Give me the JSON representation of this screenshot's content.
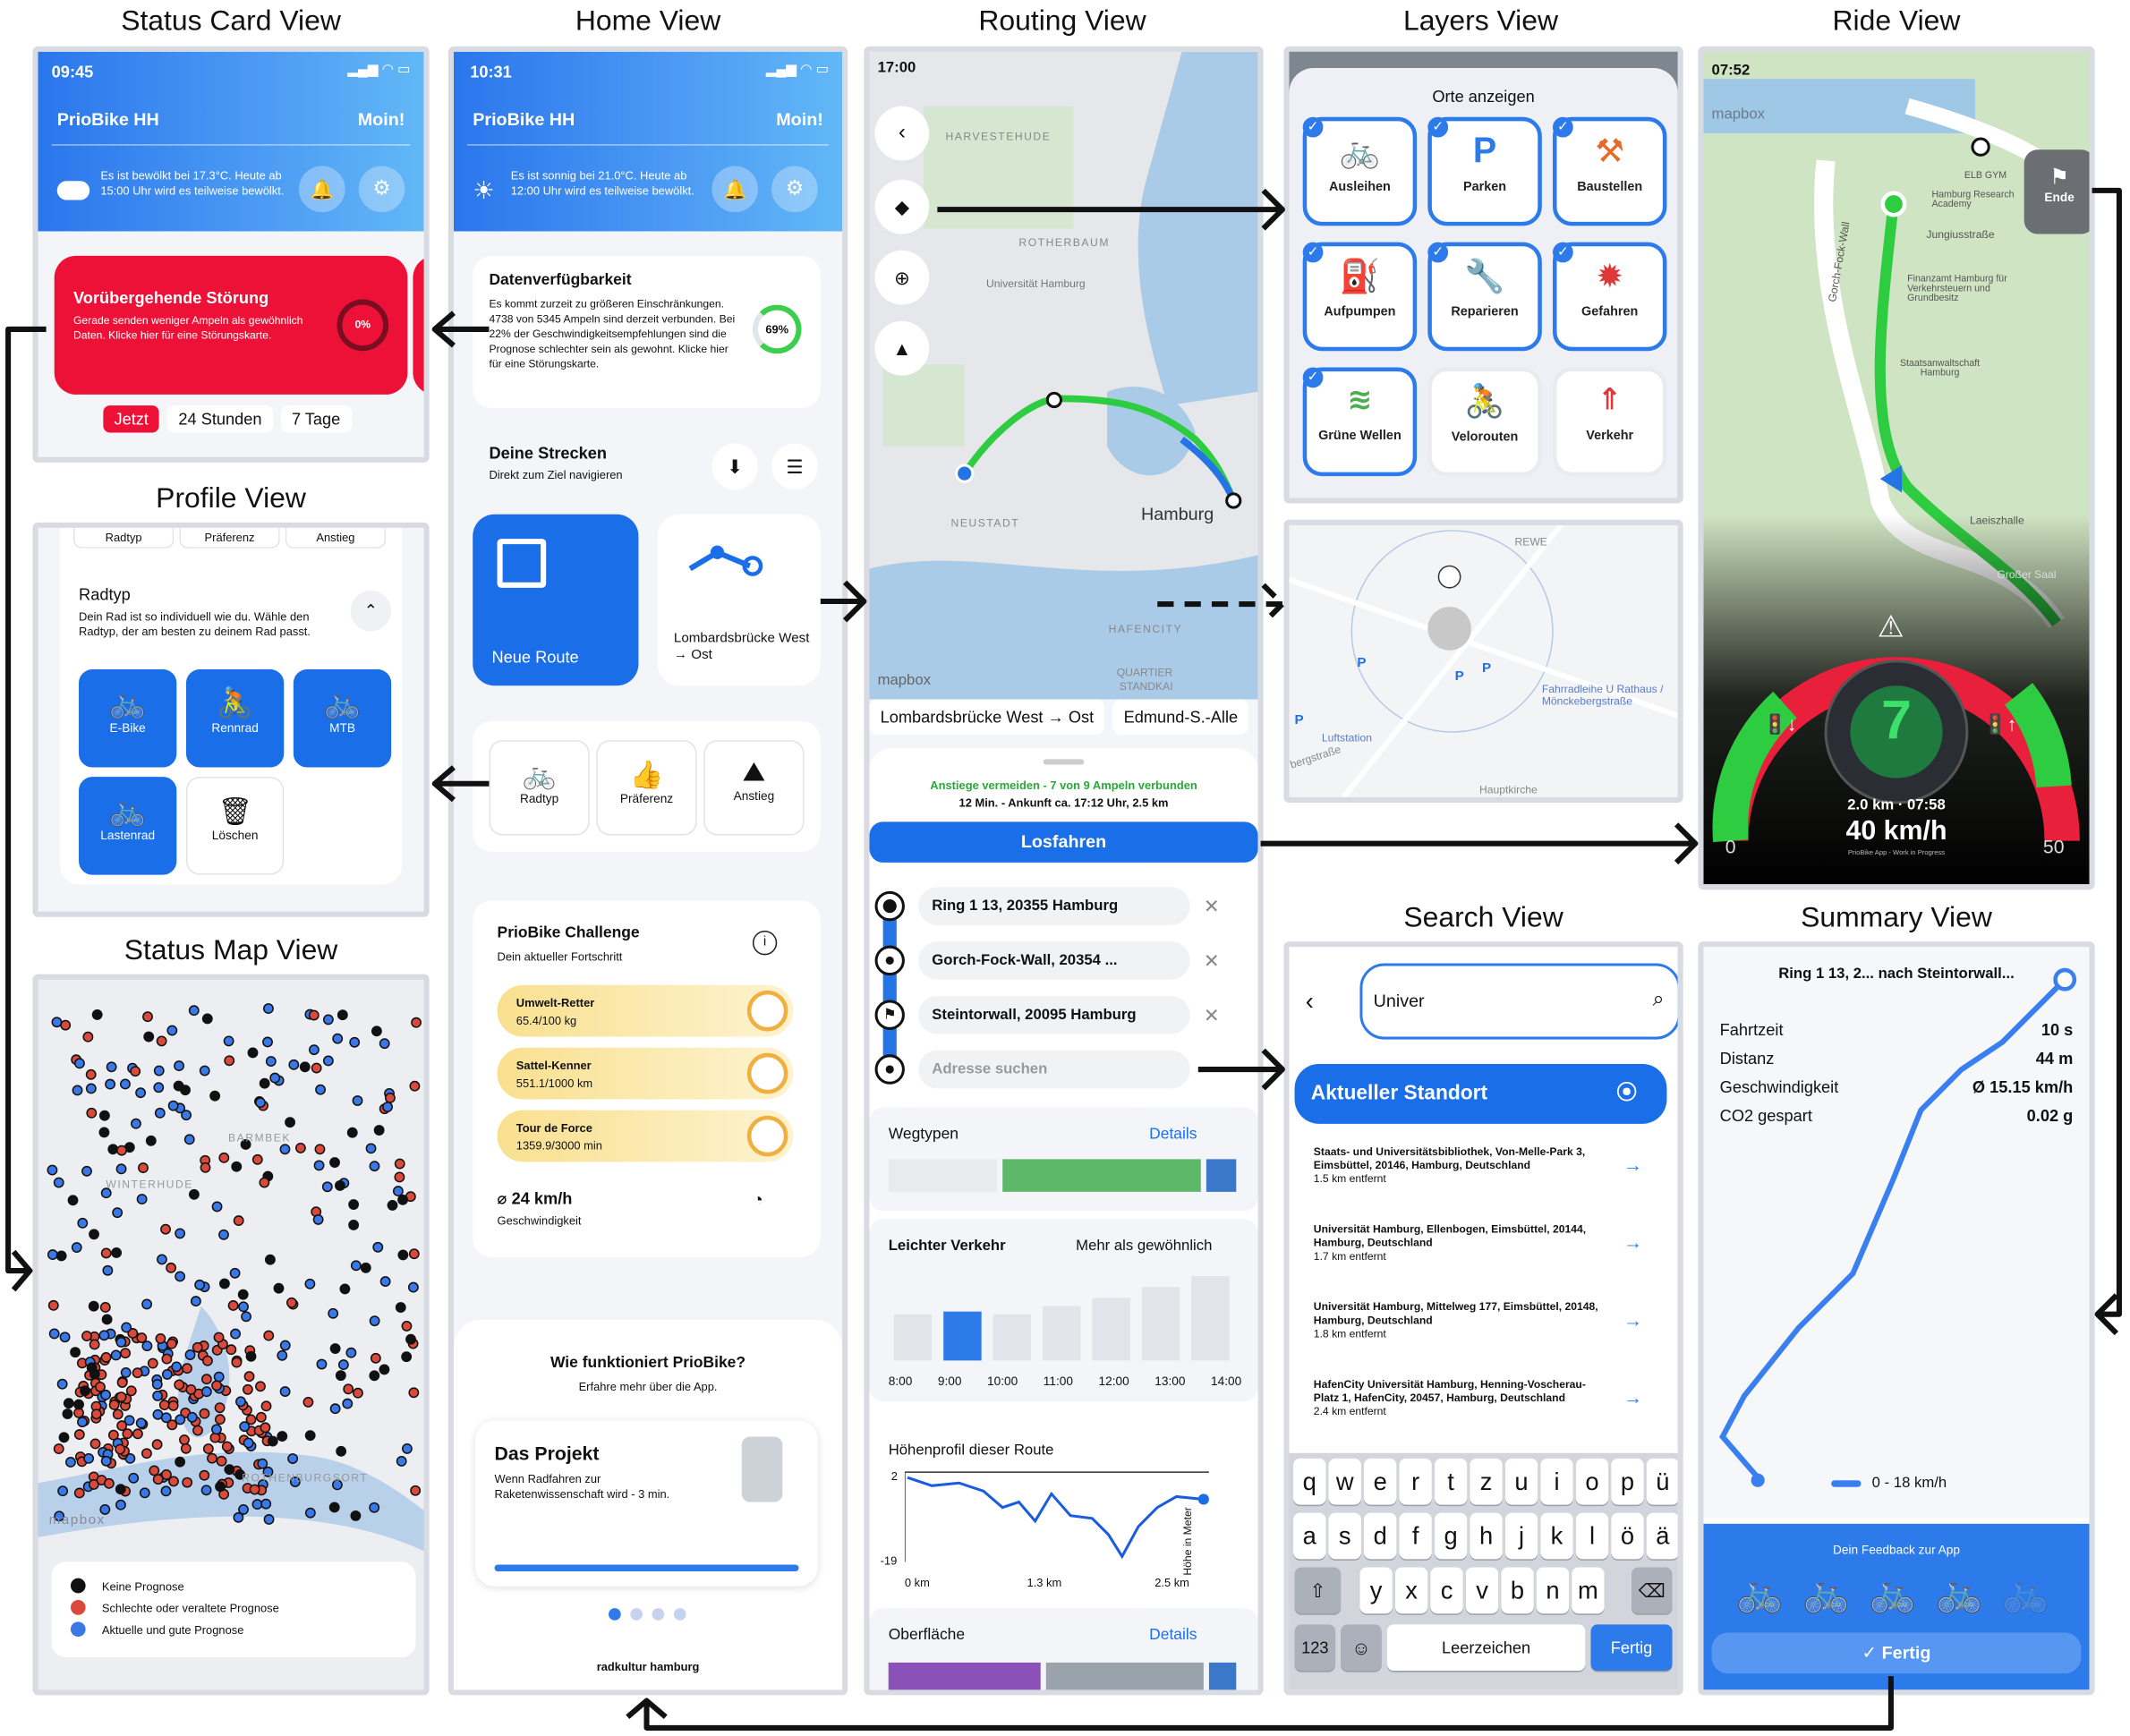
{
  "views": {
    "status_card": "Status Card View",
    "home": "Home View",
    "routing": "Routing View",
    "layers": "Layers View",
    "ride": "Ride View",
    "profile": "Profile View",
    "status_map": "Status Map View",
    "search": "Search View",
    "summary": "Summary View"
  },
  "status_card": {
    "time": "09:45",
    "app": "PrioBike HH",
    "greet": "Moin!",
    "weather": "Es ist bewölkt bei 17.3°C. Heute ab 15:00 Uhr wird es teilweise bewölkt.",
    "alert_title": "Vorübergehende Störung",
    "alert_text": "Gerade senden weniger Ampeln als gewöhnlich Daten. Klicke hier für eine Störungskarte.",
    "alert_pct": "0%",
    "tabs": [
      "Jetzt",
      "24 Stunden",
      "7 Tage"
    ]
  },
  "home": {
    "time": "10:31",
    "app": "PrioBike HH",
    "greet": "Moin!",
    "weather": "Es ist sonnig bei 21.0°C. Heute ab 12:00 Uhr wird es teilweise bewölkt.",
    "data_title": "Datenverfügbarkeit",
    "data_text": "Es kommt zurzeit zu größeren Einschränkungen. 4738 von 5345 Ampeln sind derzeit verbunden. Bei 22% der Geschwindigkeitsempfehlungen sind die Prognose schlechter sein als gewohnt. Klicke hier für eine Störungskarte.",
    "data_pct": "69%",
    "routes_title": "Deine Strecken",
    "routes_sub": "Direkt zum Ziel navigieren",
    "new_route": "Neue Route",
    "route_name": "Lombardsbrücke West → Ost",
    "prefs": [
      "Radtyp",
      "Präferenz",
      "Anstieg"
    ],
    "challenge_title": "PrioBike Challenge",
    "challenge_sub": "Dein aktueller Fortschritt",
    "challenges": [
      {
        "name": "Umwelt-Retter",
        "val": "65.4/100 kg"
      },
      {
        "name": "Sattel-Kenner",
        "val": "551.1/1000 km"
      },
      {
        "name": "Tour de Force",
        "val": "1359.9/3000 min"
      }
    ],
    "speed": "⌀ 24 km/h",
    "speed_label": "Geschwindigkeit",
    "how_title": "Wie funktioniert PrioBike?",
    "how_sub": "Erfahre mehr über die App.",
    "proj_title": "Das Projekt",
    "proj_text": "Wenn Radfahren zur Raketenwissenschaft wird - 3 min.",
    "footer": "radkultur hamburg"
  },
  "routing": {
    "time": "17:00",
    "map_labels": [
      "HARVESTEHUDE",
      "ROTHERBAUM",
      "Universität Hamburg",
      "NEUSTADT",
      "Hamburg",
      "HAFENCITY",
      "QUARTIER",
      "STANDKAI"
    ],
    "mapbox": "mapbox",
    "route_tabs": [
      "Lombardsbrücke West → Ost",
      "Edmund-S.-Alle"
    ],
    "info1": "Anstiege vermeiden - 7 von 9 Ampeln verbunden",
    "info2": "12 Min. - Ankunft ca. 17:12 Uhr, 2.5 km",
    "go": "Losfahren",
    "stops": [
      "Ring 1 13, 20355 Hamburg",
      "Gorch-Fock-Wall, 20354 ...",
      "Steintorwall, 20095 Hamburg"
    ],
    "stop_placeholder": "Adresse suchen",
    "wegtypen": "Wegtypen",
    "details": "Details",
    "traffic_title": "Leichter Verkehr",
    "traffic_sub": "Mehr als gewöhnlich",
    "hours": [
      "8:00",
      "9:00",
      "10:00",
      "11:00",
      "12:00",
      "13:00",
      "14:00"
    ],
    "elev_title": "Höhenprofil dieser Route",
    "elev_y": [
      "2",
      "-19"
    ],
    "elev_x": [
      "0 km",
      "1.3 km",
      "2.5 km"
    ],
    "elev_axis": "Höhe in Meter",
    "surface": "Oberfläche"
  },
  "layers": {
    "title": "Orte anzeigen",
    "tiles": [
      "Ausleihen",
      "Parken",
      "Baustellen",
      "Aufpumpen",
      "Reparieren",
      "Gefahren",
      "Grüne Wellen",
      "Velorouten",
      "Verkehr"
    ],
    "map_labels": [
      "REWE",
      "Fahrradleihe U Rathaus / Mönckebergstraße",
      "Luftstation",
      "Hauptkirche",
      "bergstraße"
    ]
  },
  "ride": {
    "time": "07:52",
    "mapbox": "mapbox",
    "end": "Ende",
    "map_labels": [
      "ELB GYM",
      "Hamburg Research Academy",
      "Jungiusstraße",
      "Finanzamt Hamburg für Verkehrsteuern und Grundbesitz",
      "Staatsanwaltschaft Hamburg",
      "Laeiszhalle",
      "Großer Saal",
      "Gorch-Fock-Wall"
    ],
    "countdown": "7",
    "dist": "2.0 km · 07:58",
    "speed": "40 km/h",
    "min": "0",
    "max": "50",
    "foot": "PrioBike App - Work in Progress"
  },
  "profile": {
    "top": [
      "Radtyp",
      "Präferenz",
      "Anstieg"
    ],
    "title": "Radtyp",
    "text": "Dein Rad ist so individuell wie du. Wähle den Radtyp, der am besten zu deinem Rad passt.",
    "bikes": [
      "E-Bike",
      "Rennrad",
      "MTB",
      "Lastenrad"
    ],
    "delete": "Löschen"
  },
  "status_map": {
    "legend": [
      "Keine Prognose",
      "Schlechte oder veraltete Prognose",
      "Aktuelle und gute Prognose"
    ],
    "legend_colors": [
      "#111111",
      "#d94a3a",
      "#3b78e7"
    ],
    "labels": [
      "BARMBEK",
      "WINTERHUDE",
      "ROTHENBURGSORT"
    ],
    "mapbox": "mapbox"
  },
  "search": {
    "query": "Univer",
    "current": "Aktueller Standort",
    "results": [
      {
        "t": "Staats- und Universitätsbibliothek, Von-Melle-Park 3, Eimsbüttel, 20146, Hamburg, Deutschland",
        "d": "1.5 km entfernt"
      },
      {
        "t": "Universität Hamburg, Ellenbogen, Eimsbüttel, 20144, Hamburg, Deutschland",
        "d": "1.7 km entfernt"
      },
      {
        "t": "Universität Hamburg, Mittelweg 177, Eimsbüttel, 20148, Hamburg, Deutschland",
        "d": "1.8 km entfernt"
      },
      {
        "t": "HafenCity Universität Hamburg, Henning-Voscherau-Platz 1, HafenCity, 20457, Hamburg, Deutschland",
        "d": "2.4 km entfernt"
      }
    ],
    "kb1": [
      "q",
      "w",
      "e",
      "r",
      "t",
      "z",
      "u",
      "i",
      "o",
      "p",
      "ü"
    ],
    "kb2": [
      "a",
      "s",
      "d",
      "f",
      "g",
      "h",
      "j",
      "k",
      "l",
      "ö",
      "ä"
    ],
    "kb3": [
      "y",
      "x",
      "c",
      "v",
      "b",
      "n",
      "m"
    ],
    "k123": "123",
    "space": "Leerzeichen",
    "done": "Fertig"
  },
  "summary": {
    "title": "Ring 1 13, 2... nach Steintorwall...",
    "rows": [
      {
        "k": "Fahrtzeit",
        "v": "10 s"
      },
      {
        "k": "Distanz",
        "v": "44 m"
      },
      {
        "k": "Geschwindigkeit",
        "v": "Ø 15.15 km/h"
      },
      {
        "k": "CO2 gespart",
        "v": "0.02 g"
      }
    ],
    "legend": "0 - 18 km/h",
    "feedback": "Dein Feedback zur App",
    "done": "Fertig"
  }
}
